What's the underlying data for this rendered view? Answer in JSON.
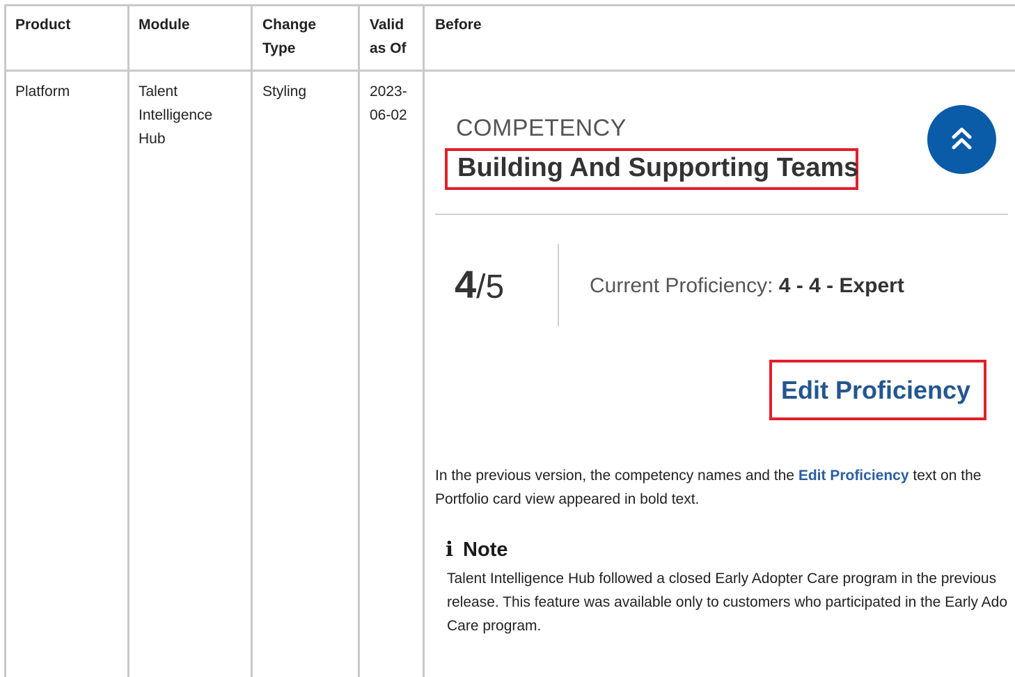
{
  "table": {
    "headers": {
      "product": [
        "Product"
      ],
      "module": [
        "Module"
      ],
      "change_type": [
        "Change",
        "Type"
      ],
      "valid_as_of": [
        "Valid",
        "as Of"
      ],
      "before": [
        "Before"
      ]
    },
    "row": {
      "product": [
        "Platform"
      ],
      "module": [
        "Talent",
        "Intelligence",
        "Hub"
      ],
      "change_type": [
        "Styling"
      ],
      "valid_as_of": [
        "2023-",
        "06-02"
      ]
    }
  },
  "before": {
    "screenshot": {
      "section_label": "COMPETENCY",
      "competency_name": "Building And Supporting Teams",
      "collapse_icon": "double-chevron-up-icon",
      "accent_color": "#0a5ba8",
      "highlight_color": "#e0202a",
      "score_value": "4",
      "score_total": "/5",
      "proficiency_label": "Current Proficiency: ",
      "proficiency_value": "4 - 4 - Expert",
      "edit_link": "Edit Proficiency"
    },
    "description": {
      "line1_before": "In the previous version, the competency names and the ",
      "line1_link": "Edit Proficiency",
      "line1_after": " text on the",
      "line2": "Portfolio card view appeared in bold text."
    },
    "note": {
      "icon": "info-icon",
      "icon_glyph": "i",
      "title": "Note",
      "lines": [
        "Talent Intelligence Hub followed a closed Early Adopter Care program in the previous",
        "release. This feature was available only to customers who participated in the Early Adopter",
        "Care program."
      ]
    }
  }
}
